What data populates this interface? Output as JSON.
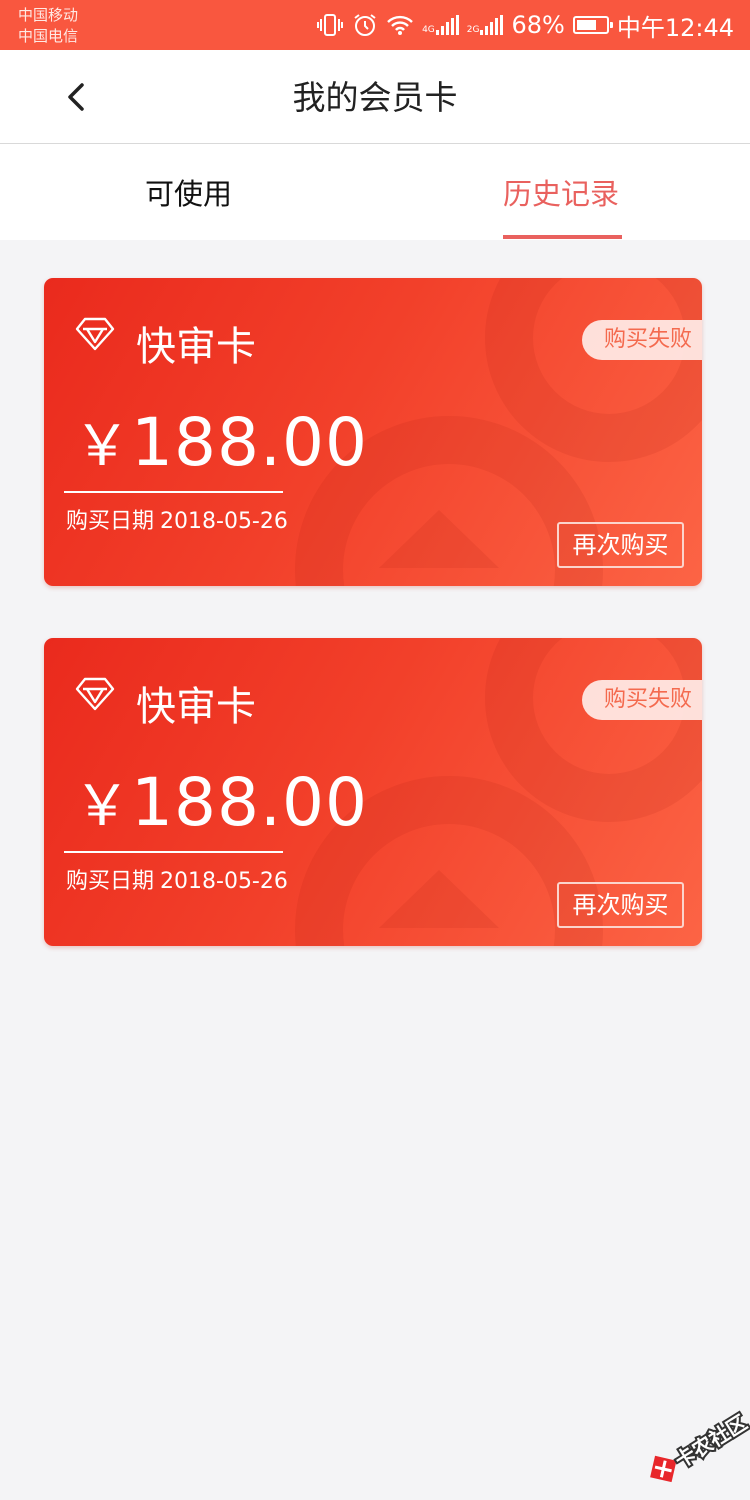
{
  "status_bar": {
    "carrier1": "中国移动",
    "carrier2": "中国电信",
    "net1": "4G",
    "net2": "2G",
    "battery_text": "68%",
    "battery_level": 0.68,
    "time": "中午12:44",
    "icons": [
      "vibrate-icon",
      "alarm-icon",
      "wifi-icon",
      "signal-icon",
      "battery-icon"
    ]
  },
  "header": {
    "title": "我的会员卡",
    "back_icon": "chevron-left-icon"
  },
  "tabs": [
    {
      "label": "可使用",
      "active": false
    },
    {
      "label": "历史记录",
      "active": true
    }
  ],
  "cards": [
    {
      "name": "快审卡",
      "status": "购买失败",
      "currency": "￥",
      "price": "188.00",
      "date_label": "购买日期",
      "date": "2018-05-26",
      "action": "再次购买"
    },
    {
      "name": "快审卡",
      "status": "购买失败",
      "currency": "￥",
      "price": "188.00",
      "date_label": "购买日期",
      "date": "2018-05-26",
      "action": "再次购买"
    }
  ],
  "watermark": {
    "text": "卡农社区"
  },
  "colors": {
    "status_bar": "#f9573f",
    "accent": "#e9615e",
    "card_start": "#ea2a1d",
    "card_end": "#fc6445",
    "background": "#f4f4f6"
  }
}
